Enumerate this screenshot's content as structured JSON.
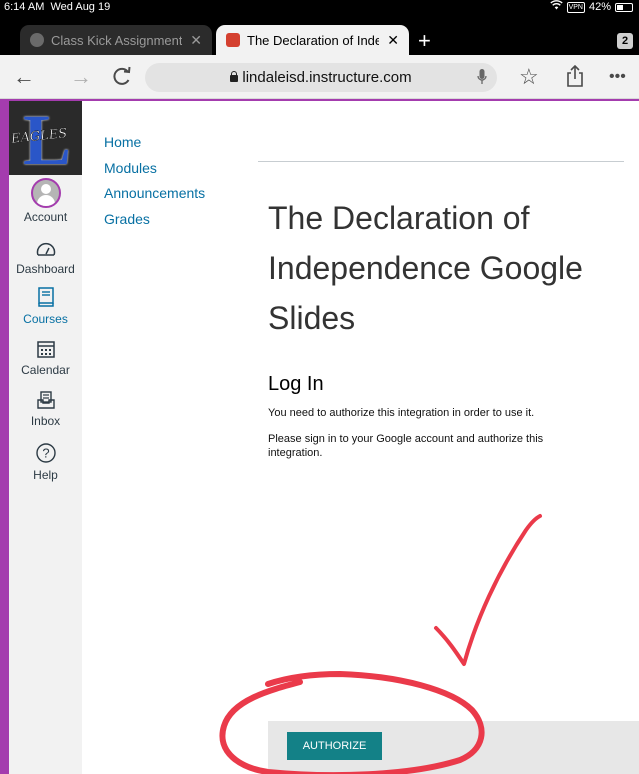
{
  "status_bar": {
    "time": "6:14 AM",
    "date": "Wed Aug 19",
    "vpn": "VPN",
    "battery": "42%"
  },
  "tabs": [
    {
      "title": "Class Kick Assignment",
      "active": false
    },
    {
      "title": "The Declaration of Independence Google Slides",
      "active": true
    }
  ],
  "tab_count": "2",
  "url": "lindaleisd.instructure.com",
  "global_nav": {
    "logo_text": "EAGLES",
    "logo_letter": "L",
    "items": [
      {
        "label": "Account",
        "icon": "avatar-icon"
      },
      {
        "label": "Dashboard",
        "icon": "dashboard-icon"
      },
      {
        "label": "Courses",
        "icon": "courses-icon",
        "active": true
      },
      {
        "label": "Calendar",
        "icon": "calendar-icon"
      },
      {
        "label": "Inbox",
        "icon": "inbox-icon"
      },
      {
        "label": "Help",
        "icon": "help-icon"
      }
    ]
  },
  "course_nav": [
    "Home",
    "Modules",
    "Announcements",
    "Grades"
  ],
  "main": {
    "title": "The Declaration of Independence Google Slides",
    "login_heading": "Log In",
    "login_text_1": "You need to authorize this integration in order to use it.",
    "login_text_2": "Please sign in to your Google account and authorize this integration.",
    "authorize_label": "AUTHORIZE"
  },
  "colors": {
    "accent": "#a43cae",
    "link": "#0770a3",
    "button": "#138187",
    "annotation": "#ea3a4a"
  }
}
